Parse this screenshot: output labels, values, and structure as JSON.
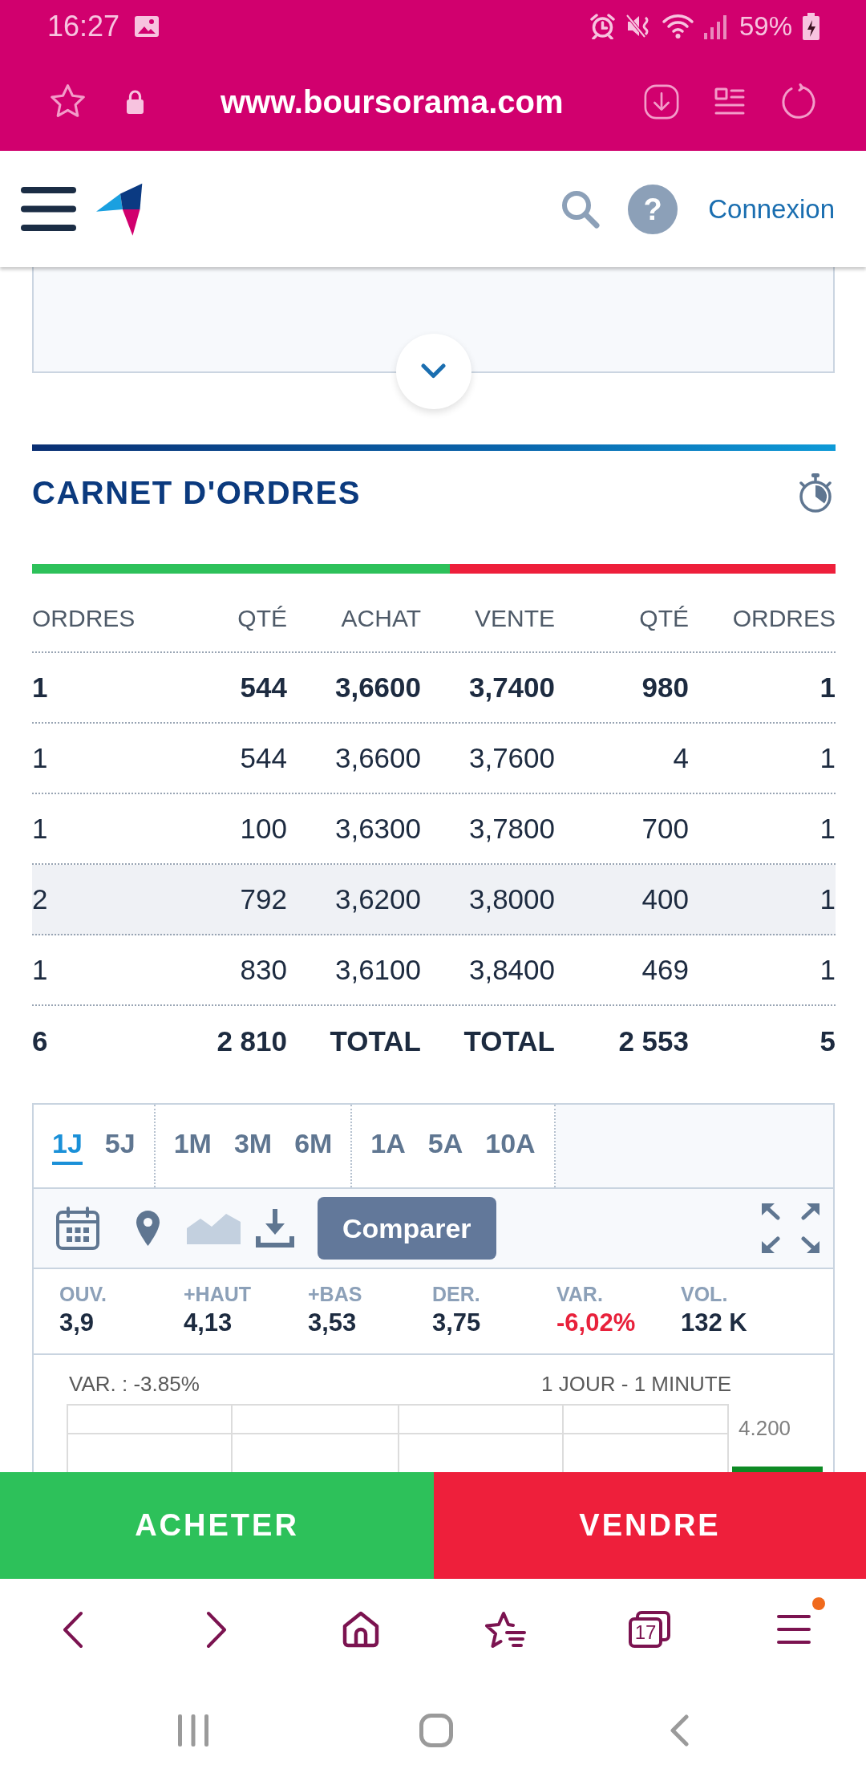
{
  "status_bar": {
    "time": "16:27",
    "battery": "59%"
  },
  "browser_bar": {
    "url": "www.boursorama.com"
  },
  "site_header": {
    "help_button": "?",
    "login_link": "Connexion"
  },
  "order_book": {
    "title": "CARNET D'ORDRES",
    "balance": {
      "level": 0.52
    },
    "columns": [
      "ORDRES",
      "QTÉ",
      "ACHAT",
      "VENTE",
      "QTÉ",
      "ORDRES"
    ],
    "rows": [
      {
        "cells": [
          "1",
          "544",
          "3,6600",
          "3,7400",
          "980",
          "1"
        ],
        "emphasized": true,
        "highlighted": false
      },
      {
        "cells": [
          "1",
          "544",
          "3,6600",
          "3,7600",
          "4",
          "1"
        ],
        "emphasized": false,
        "highlighted": false
      },
      {
        "cells": [
          "1",
          "100",
          "3,6300",
          "3,7800",
          "700",
          "1"
        ],
        "emphasized": false,
        "highlighted": false
      },
      {
        "cells": [
          "2",
          "792",
          "3,6200",
          "3,8000",
          "400",
          "1"
        ],
        "emphasized": false,
        "highlighted": true
      },
      {
        "cells": [
          "1",
          "830",
          "3,6100",
          "3,8400",
          "469",
          "1"
        ],
        "emphasized": false,
        "highlighted": false
      }
    ],
    "totals": [
      "6",
      "2 810",
      "TOTAL",
      "TOTAL",
      "2 553",
      "5"
    ]
  },
  "chart_panel": {
    "period_groups": [
      {
        "periods": [
          {
            "label": "1J",
            "selected": true
          },
          {
            "label": "5J",
            "selected": false
          }
        ]
      },
      {
        "periods": [
          {
            "label": "1M",
            "selected": false
          },
          {
            "label": "3M",
            "selected": false
          },
          {
            "label": "6M",
            "selected": false
          }
        ]
      },
      {
        "periods": [
          {
            "label": "1A",
            "selected": false
          },
          {
            "label": "5A",
            "selected": false
          },
          {
            "label": "10A",
            "selected": false
          }
        ]
      }
    ],
    "compare_button": "Comparer",
    "stats": [
      {
        "label": "OUV.",
        "value": "3,9",
        "negative": false
      },
      {
        "label": "+HAUT",
        "value": "4,13",
        "negative": false
      },
      {
        "label": "+BAS",
        "value": "3,53",
        "negative": false
      },
      {
        "label": "DER.",
        "value": "3,75",
        "negative": false
      },
      {
        "label": "VAR.",
        "value": "-6,02%",
        "negative": true
      },
      {
        "label": "VOL.",
        "value": "132 K",
        "negative": false
      }
    ],
    "chart": {
      "variation": "VAR. : -3.85%",
      "interval": "1 JOUR - 1 MINUTE",
      "axis_label": "4.200"
    }
  },
  "trade_buttons": {
    "buy": "ACHETER",
    "sell": "VENDRE"
  },
  "browser_nav": {
    "tab_count": "17",
    "menu_notification": true
  }
}
